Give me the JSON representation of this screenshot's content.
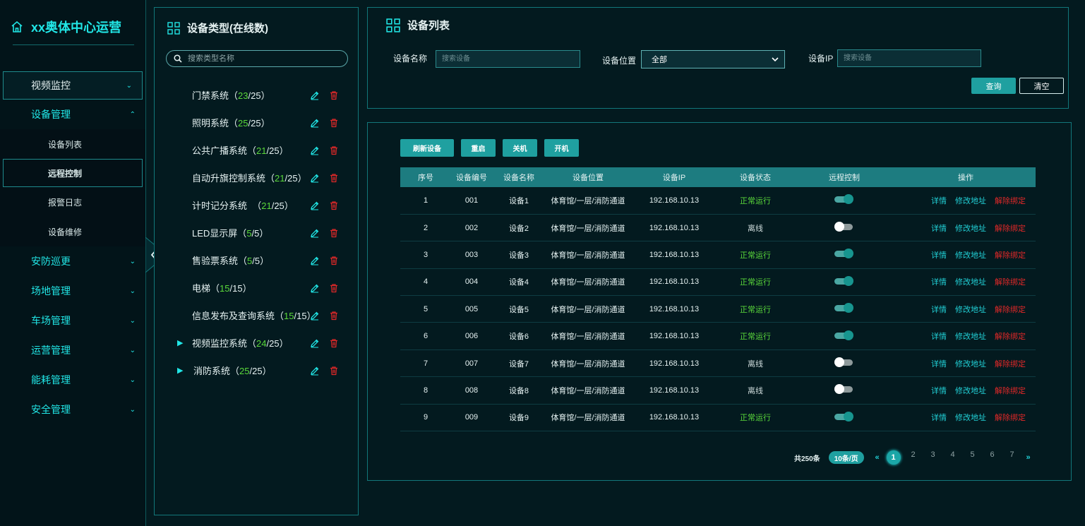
{
  "app": {
    "title": "xx奥体中心运营"
  },
  "sidebar": {
    "items": [
      {
        "label": "视频监控",
        "chevron": "chevron-down"
      },
      {
        "label": "设备管理",
        "chevron": "chevron-up"
      },
      {
        "label": "安防巡更",
        "chevron": "chevron-down"
      },
      {
        "label": "场地管理",
        "chevron": "chevron-down"
      },
      {
        "label": "车场管理",
        "chevron": "chevron-down"
      },
      {
        "label": "运营管理",
        "chevron": "chevron-down"
      },
      {
        "label": "能耗管理",
        "chevron": "chevron-down"
      },
      {
        "label": "安全管理",
        "chevron": "chevron-down"
      }
    ],
    "sub_items": [
      {
        "label": "设备列表"
      },
      {
        "label": "远程控制"
      },
      {
        "label": "报警日志"
      },
      {
        "label": "设备维修"
      }
    ]
  },
  "types_panel": {
    "title": "设备类型(在线数)",
    "search_placeholder": "搜索类型名称",
    "items": [
      {
        "name": "门禁系统",
        "pre": "（",
        "online": "23",
        "total": "/25",
        "post": "）"
      },
      {
        "name": "照明系统",
        "pre": "（",
        "online": "25",
        "total": "/25",
        "post": "）"
      },
      {
        "name": "公共广播系统",
        "pre": "（",
        "online": "21",
        "total": "/25",
        "post": "）"
      },
      {
        "name": "自动升旗控制系统",
        "pre": "（",
        "online": "21",
        "total": "/25",
        "post": "）"
      },
      {
        "name": "计时记分系统",
        "pre": "  （",
        "online": "21",
        "total": "/25",
        "post": "）"
      },
      {
        "name": "LED显示屏",
        "pre": "（",
        "online": "5",
        "total": "/5",
        "post": "）"
      },
      {
        "name": "售验票系统",
        "pre": "（",
        "online": "5",
        "total": "/5",
        "post": "）"
      },
      {
        "name": "电梯",
        "pre": "（",
        "online": "15",
        "total": "/15",
        "post": "）"
      },
      {
        "name": "信息发布及查询系统",
        "pre": "（",
        "online": "15",
        "total": "/15",
        "post": "）"
      },
      {
        "name": "视频监控系统",
        "pre": "（",
        "online": "24",
        "total": "/25",
        "post": "）",
        "expandable": true
      },
      {
        "name": "消防系统",
        "pre": "（",
        "online": "25",
        "total": "/25",
        "post": "）",
        "expandable": true
      }
    ]
  },
  "filter": {
    "title": "设备列表",
    "name_label": "设备名称",
    "name_placeholder": "搜索设备",
    "location_label": "设备位置",
    "location_value": "全部",
    "ip_label": "设备IP",
    "ip_placeholder": "搜索设备",
    "query_label": "查询",
    "clear_label": "清空"
  },
  "table": {
    "actions": [
      "刷新设备",
      "重启",
      "关机",
      "开机"
    ],
    "headers": [
      "序号",
      "设备编号",
      "设备名称",
      "设备位置",
      "设备IP",
      "设备状态",
      "远程控制",
      "操作"
    ],
    "op_labels": {
      "detail": "详情",
      "edit": "修改地址",
      "unbind": "解除绑定"
    },
    "rows": [
      {
        "idx": "1",
        "code": "001",
        "name": "设备1",
        "location": "体育馆/一层/消防通道",
        "ip": "192.168.10.13",
        "status": "正常运行",
        "online": true
      },
      {
        "idx": "2",
        "code": "002",
        "name": "设备2",
        "location": "体育馆/一层/消防通道",
        "ip": "192.168.10.13",
        "status": "离线",
        "online": false
      },
      {
        "idx": "3",
        "code": "003",
        "name": "设备3",
        "location": "体育馆/一层/消防通道",
        "ip": "192.168.10.13",
        "status": "正常运行",
        "online": true
      },
      {
        "idx": "4",
        "code": "004",
        "name": "设备4",
        "location": "体育馆/一层/消防通道",
        "ip": "192.168.10.13",
        "status": "正常运行",
        "online": true
      },
      {
        "idx": "5",
        "code": "005",
        "name": "设备5",
        "location": "体育馆/一层/消防通道",
        "ip": "192.168.10.13",
        "status": "正常运行",
        "online": true
      },
      {
        "idx": "6",
        "code": "006",
        "name": "设备6",
        "location": "体育馆/一层/消防通道",
        "ip": "192.168.10.13",
        "status": "正常运行",
        "online": true
      },
      {
        "idx": "7",
        "code": "007",
        "name": "设备7",
        "location": "体育馆/一层/消防通道",
        "ip": "192.168.10.13",
        "status": "离线",
        "online": false
      },
      {
        "idx": "8",
        "code": "008",
        "name": "设备8",
        "location": "体育馆/一层/消防通道",
        "ip": "192.168.10.13",
        "status": "离线",
        "online": false
      },
      {
        "idx": "9",
        "code": "009",
        "name": "设备9",
        "location": "体育馆/一层/消防通道",
        "ip": "192.168.10.13",
        "status": "正常运行",
        "online": true
      }
    ]
  },
  "pagination": {
    "total": "共250条",
    "page_size": "10条/页",
    "prev": "«",
    "next": "»",
    "pages": [
      "1",
      "2",
      "3",
      "4",
      "5",
      "6",
      "7"
    ],
    "current": "1"
  },
  "colors": {
    "accent": "#21e6e6",
    "button": "#1fa0a0",
    "online": "#5ad83a",
    "danger": "#e02828",
    "border": "#12777a"
  }
}
